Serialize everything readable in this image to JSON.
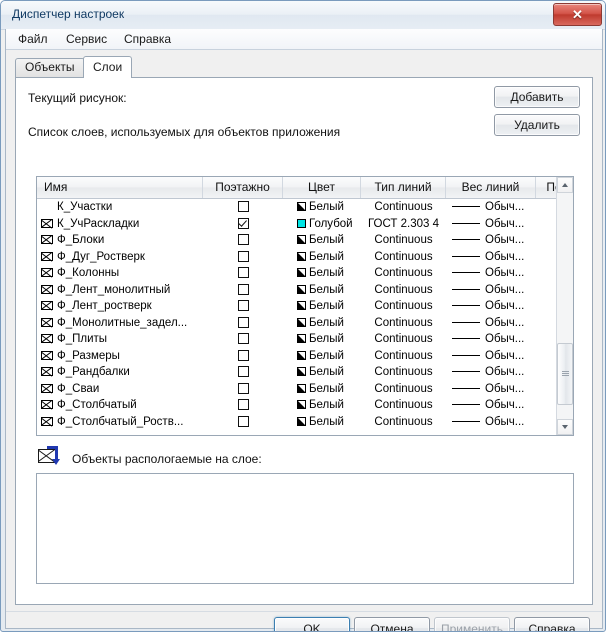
{
  "window": {
    "title": "Диспетчер настроек",
    "close_label": "✕"
  },
  "menubar": {
    "items": [
      {
        "label": "Файл"
      },
      {
        "label": "Сервис"
      },
      {
        "label": "Справка"
      }
    ]
  },
  "tabs": [
    {
      "label": "Объекты",
      "active": false
    },
    {
      "label": "Слои",
      "active": true
    }
  ],
  "page": {
    "current_drawing_label": "Текущий рисунок:",
    "current_drawing_value": "",
    "layer_list_label": "Список слоев, используемых для объектов приложения",
    "objects_on_layer_label": "Объекты распологаемые на слое:",
    "objects_on_layer_items": []
  },
  "side_buttons": {
    "add_label": "Добавить",
    "delete_label": "Удалить"
  },
  "grid": {
    "columns": [
      {
        "key": "name",
        "label": "Имя"
      },
      {
        "key": "by_floor",
        "label": "Поэтажно"
      },
      {
        "key": "color",
        "label": "Цвет"
      },
      {
        "key": "line_type",
        "label": "Тип линий"
      },
      {
        "key": "line_weight",
        "label": "Вес линий"
      },
      {
        "key": "print",
        "label": "Печать"
      }
    ],
    "rows": [
      {
        "name": "К_Участки",
        "has_envelope": false,
        "by_floor": false,
        "color": "Белый",
        "swatch": "white",
        "line_type": "Continuous",
        "line_weight": "Обыч...",
        "print": true
      },
      {
        "name": "К_УчРаскладки",
        "has_envelope": true,
        "by_floor": true,
        "color": "Голубой",
        "swatch": "cyan",
        "line_type": "ГОСТ 2.303 4",
        "line_weight": "Обыч...",
        "print": false
      },
      {
        "name": "Ф_Блоки",
        "has_envelope": true,
        "by_floor": false,
        "color": "Белый",
        "swatch": "white",
        "line_type": "Continuous",
        "line_weight": "Обыч...",
        "print": true
      },
      {
        "name": "Ф_Дуг_Ростверк",
        "has_envelope": true,
        "by_floor": false,
        "color": "Белый",
        "swatch": "white",
        "line_type": "Continuous",
        "line_weight": "Обыч...",
        "print": true
      },
      {
        "name": "Ф_Колонны",
        "has_envelope": true,
        "by_floor": false,
        "color": "Белый",
        "swatch": "white",
        "line_type": "Continuous",
        "line_weight": "Обыч...",
        "print": true
      },
      {
        "name": "Ф_Лент_монолитный",
        "has_envelope": true,
        "by_floor": false,
        "color": "Белый",
        "swatch": "white",
        "line_type": "Continuous",
        "line_weight": "Обыч...",
        "print": true
      },
      {
        "name": "Ф_Лент_ростверк",
        "has_envelope": true,
        "by_floor": false,
        "color": "Белый",
        "swatch": "white",
        "line_type": "Continuous",
        "line_weight": "Обыч...",
        "print": true
      },
      {
        "name": "Ф_Монолитные_задел...",
        "has_envelope": true,
        "by_floor": false,
        "color": "Белый",
        "swatch": "white",
        "line_type": "Continuous",
        "line_weight": "Обыч...",
        "print": true
      },
      {
        "name": "Ф_Плиты",
        "has_envelope": true,
        "by_floor": false,
        "color": "Белый",
        "swatch": "white",
        "line_type": "Continuous",
        "line_weight": "Обыч...",
        "print": true
      },
      {
        "name": "Ф_Размеры",
        "has_envelope": true,
        "by_floor": false,
        "color": "Белый",
        "swatch": "white",
        "line_type": "Continuous",
        "line_weight": "Обыч...",
        "print": true
      },
      {
        "name": "Ф_Рандбалки",
        "has_envelope": true,
        "by_floor": false,
        "color": "Белый",
        "swatch": "white",
        "line_type": "Continuous",
        "line_weight": "Обыч...",
        "print": true
      },
      {
        "name": "Ф_Сваи",
        "has_envelope": true,
        "by_floor": false,
        "color": "Белый",
        "swatch": "white",
        "line_type": "Continuous",
        "line_weight": "Обыч...",
        "print": true
      },
      {
        "name": "Ф_Столбчатый",
        "has_envelope": true,
        "by_floor": false,
        "color": "Белый",
        "swatch": "white",
        "line_type": "Continuous",
        "line_weight": "Обыч...",
        "print": true
      },
      {
        "name": "Ф_Столбчатый_Роств...",
        "has_envelope": true,
        "by_floor": false,
        "color": "Белый",
        "swatch": "white",
        "line_type": "Continuous",
        "line_weight": "Обыч...",
        "print": true
      }
    ]
  },
  "footer_buttons": [
    {
      "label": "OK",
      "default": true,
      "disabled": false
    },
    {
      "label": "Отмена",
      "default": false,
      "disabled": false
    },
    {
      "label": "Применить",
      "default": false,
      "disabled": true
    },
    {
      "label": "Справка",
      "default": false,
      "disabled": false
    }
  ],
  "colors": {
    "accent": "#3c7fb1",
    "title_text": "#103a63",
    "close_button": "#bf3a2e",
    "cyan_swatch": "#00e5e5",
    "print_disabled_badge": "#d93b2b"
  }
}
